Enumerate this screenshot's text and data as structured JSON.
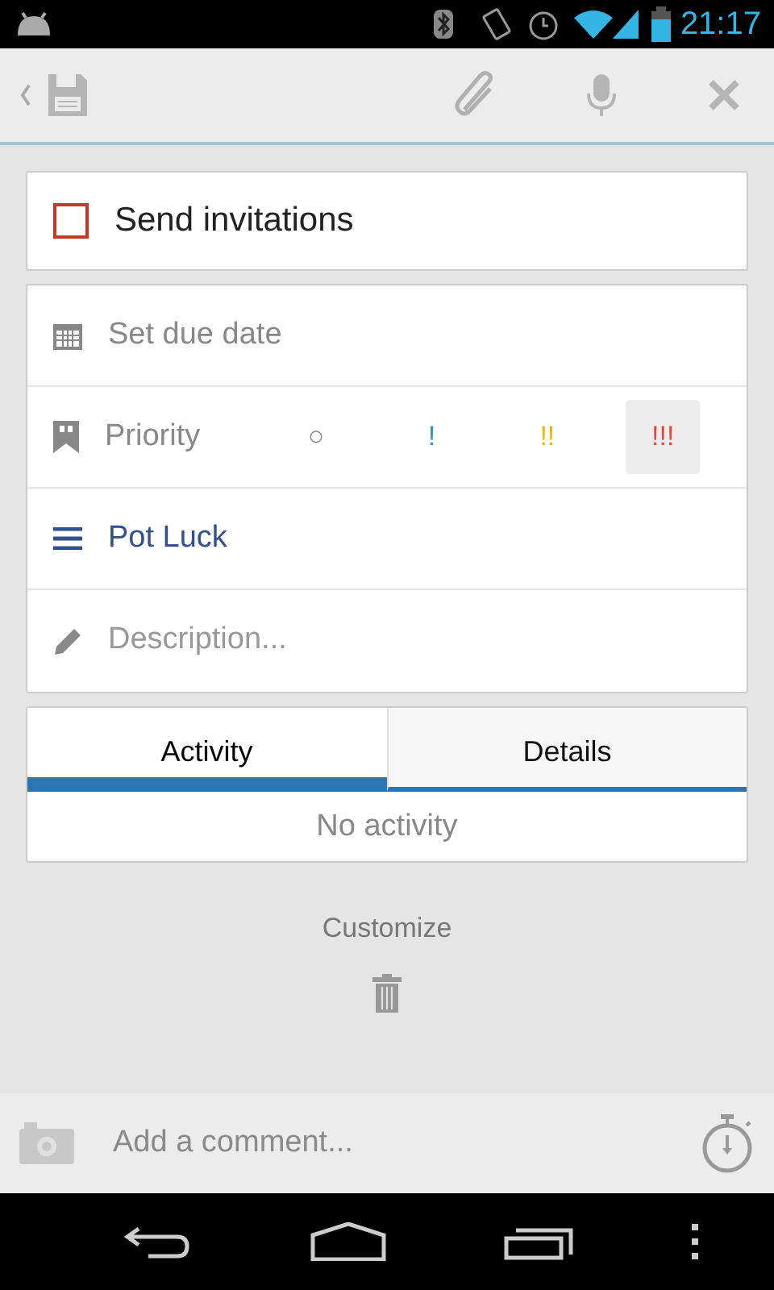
{
  "status_bar": {
    "time": "21:17"
  },
  "task": {
    "title": "Send invitations",
    "completed": false
  },
  "fields": [
    {
      "kind": "date",
      "label": "Set due date"
    },
    {
      "kind": "priority",
      "label": "Priority",
      "levels": [
        {
          "label": "○",
          "color": "#8a8a8a",
          "selected": false
        },
        {
          "label": "!",
          "color": "#3b8ed0",
          "selected": false
        },
        {
          "label": "!!",
          "color": "#e2bc1a",
          "selected": false
        },
        {
          "label": "!!!",
          "color": "#e04a3f",
          "selected": true
        }
      ]
    },
    {
      "kind": "list",
      "value": "Pot Luck"
    },
    {
      "kind": "description",
      "placeholder": "Description..."
    }
  ],
  "tabs": [
    {
      "label": "Activity",
      "selected": true
    },
    {
      "label": "Details",
      "selected": false
    }
  ],
  "activity_empty": "No activity",
  "customize": "Customize",
  "comment": {
    "placeholder": "Add a comment..."
  }
}
